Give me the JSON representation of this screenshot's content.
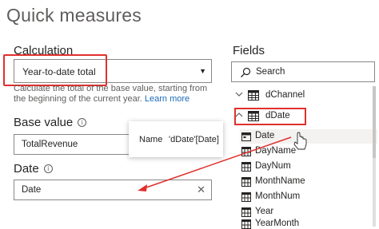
{
  "title": "Quick measures",
  "calculation": {
    "label": "Calculation",
    "selected": "Year-to-date total",
    "description": "Calculate the total of the base value, starting from the beginning of the current year.",
    "learn_more": "Learn more"
  },
  "base_value": {
    "label": "Base value",
    "value": "TotalRevenue"
  },
  "date": {
    "label": "Date",
    "value": "Date",
    "clear": "✕"
  },
  "tooltip": {
    "name_label": "Name",
    "name_value": "'dDate'[Date]"
  },
  "fields": {
    "label": "Fields",
    "search_placeholder": "Search",
    "tables": [
      {
        "name": "dChannel",
        "expanded": false
      },
      {
        "name": "dDate",
        "expanded": true
      }
    ],
    "ddate_fields": [
      "Date",
      "DayName",
      "DayNum",
      "MonthName",
      "MonthNum",
      "Year",
      "YearMonth"
    ]
  },
  "colors": {
    "highlight_red": "#e0302d",
    "link_blue": "#1c6bb8",
    "hover_gray": "#f3f2f1"
  },
  "icons": {
    "info": "info-icon",
    "caret": "chevron-down-icon",
    "clear": "close-icon",
    "search": "search-icon",
    "table": "table-icon",
    "calendar": "calendar-icon",
    "field": "field-icon"
  }
}
